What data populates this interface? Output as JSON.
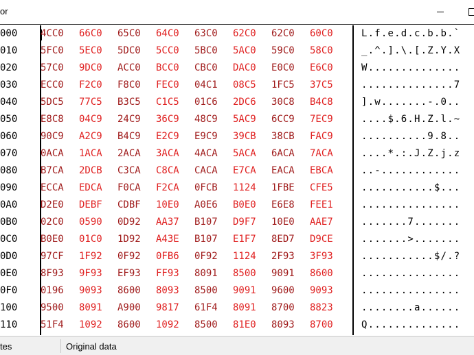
{
  "window": {
    "title": "or",
    "minimize_glyph": "minimize-icon",
    "maximize_glyph": "maximize-icon"
  },
  "rows": [
    {
      "offset": "000",
      "hex": [
        "4CC0",
        "66C0",
        "65C0",
        "64C0",
        "63C0",
        "62C0",
        "62C0",
        "60C0"
      ],
      "ascii": "L.f.e.d.c.b.b.`"
    },
    {
      "offset": "010",
      "hex": [
        "5FC0",
        "5EC0",
        "5DC0",
        "5CC0",
        "5BC0",
        "5AC0",
        "59C0",
        "58C0"
      ],
      "ascii": "_.^.].\\.[.Z.Y.X"
    },
    {
      "offset": "020",
      "hex": [
        "57C0",
        "9DC0",
        "ACC0",
        "BCC0",
        "CBC0",
        "DAC0",
        "E0C0",
        "E6C0"
      ],
      "ascii": "W.............."
    },
    {
      "offset": "030",
      "hex": [
        "ECC0",
        "F2C0",
        "F8C0",
        "FEC0",
        "04C1",
        "08C5",
        "1FC5",
        "37C5"
      ],
      "ascii": "..............7"
    },
    {
      "offset": "040",
      "hex": [
        "5DC5",
        "77C5",
        "B3C5",
        "C1C5",
        "01C6",
        "2DC6",
        "30C8",
        "B4C8"
      ],
      "ascii": "].w.......-.0.."
    },
    {
      "offset": "050",
      "hex": [
        "E8C8",
        "04C9",
        "24C9",
        "36C9",
        "48C9",
        "5AC9",
        "6CC9",
        "7EC9"
      ],
      "ascii": "....$.6.H.Z.l.~"
    },
    {
      "offset": "060",
      "hex": [
        "90C9",
        "A2C9",
        "B4C9",
        "E2C9",
        "E9C9",
        "39CB",
        "38CB",
        "FAC9"
      ],
      "ascii": "..........9.8.."
    },
    {
      "offset": "070",
      "hex": [
        "0ACA",
        "1ACA",
        "2ACA",
        "3ACA",
        "4ACA",
        "5ACA",
        "6ACA",
        "7ACA"
      ],
      "ascii": "....*.:.J.Z.j.z"
    },
    {
      "offset": "080",
      "hex": [
        "B7CA",
        "2DCB",
        "C3CA",
        "C8CA",
        "CACA",
        "E7CA",
        "EACA",
        "EBCA"
      ],
      "ascii": "..-............"
    },
    {
      "offset": "090",
      "hex": [
        "ECCA",
        "EDCA",
        "F0CA",
        "F2CA",
        "0FCB",
        "1124",
        "1FBE",
        "CFE5"
      ],
      "ascii": "...........$..."
    },
    {
      "offset": "0A0",
      "hex": [
        "D2E0",
        "DEBF",
        "CDBF",
        "10E0",
        "A0E6",
        "B0E0",
        "E6E8",
        "FEE1"
      ],
      "ascii": "..............."
    },
    {
      "offset": "0B0",
      "hex": [
        "02C0",
        "0590",
        "0D92",
        "AA37",
        "B107",
        "D9F7",
        "10E0",
        "AAE7"
      ],
      "ascii": ".......7......."
    },
    {
      "offset": "0C0",
      "hex": [
        "B0E0",
        "01C0",
        "1D92",
        "A43E",
        "B107",
        "E1F7",
        "8ED7",
        "D9CE"
      ],
      "ascii": ".......>......."
    },
    {
      "offset": "0D0",
      "hex": [
        "97CF",
        "1F92",
        "0F92",
        "0FB6",
        "0F92",
        "1124",
        "2F93",
        "3F93"
      ],
      "ascii": "...........$/.?"
    },
    {
      "offset": "0E0",
      "hex": [
        "8F93",
        "9F93",
        "EF93",
        "FF93",
        "8091",
        "8500",
        "9091",
        "8600"
      ],
      "ascii": "..............."
    },
    {
      "offset": "0F0",
      "hex": [
        "0196",
        "9093",
        "8600",
        "8093",
        "8500",
        "9091",
        "9600",
        "9093"
      ],
      "ascii": "..............."
    },
    {
      "offset": "100",
      "hex": [
        "9500",
        "8091",
        "A900",
        "9817",
        "61F4",
        "8091",
        "8700",
        "8823"
      ],
      "ascii": "........a......"
    },
    {
      "offset": "110",
      "hex": [
        "51F4",
        "1092",
        "8600",
        "1092",
        "8500",
        "81E0",
        "8093",
        "8700"
      ],
      "ascii": "Q.............."
    }
  ],
  "status": {
    "left": "tes",
    "right": "Original data"
  }
}
